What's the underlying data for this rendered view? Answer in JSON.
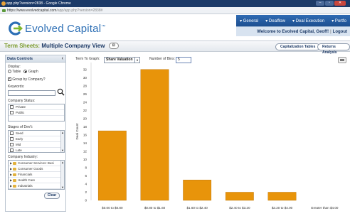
{
  "browser": {
    "title": "app.php?version=2838 - Google Chrome",
    "url_host": "https://www.evolvedcapital.com",
    "url_path": "/app/app.php?version=2838#",
    "win_min": "–",
    "win_max": "▫",
    "win_close": "✕"
  },
  "header": {
    "brand": "Evolved Capital",
    "brand_tm": "™",
    "nav": [
      "▾ General",
      "▾ Dealflow",
      "▾ Deal Execution",
      "▾ Portfo"
    ],
    "welcome": "Welcome to Evolved Capital, Geoff!",
    "logout": "Logout"
  },
  "page": {
    "title_prefix": "Term Sheets:",
    "title_main": "Multiple Company View",
    "view_icon": "⊡",
    "cap_tables_btn": "Capitalization Tables",
    "returns_btn": "Returns Analysis"
  },
  "panel": {
    "heading": "Data Controls",
    "collapse": "‹",
    "display_label": "Display:",
    "table_label": "Table",
    "graph_label": "Graph",
    "group_label": "Group by Company?",
    "keywords_label": "Keywords:",
    "search_glyph": "🔍",
    "status_label": "Company Status:",
    "status_items": [
      "Private",
      "Public"
    ],
    "stage_label": "Stages of Dev't:",
    "stage_items": [
      "Seed",
      "Early",
      "Mid",
      "Late"
    ],
    "industry_label": "Company Industry:",
    "industry_items": [
      "Consumer Services: Busi",
      "Consumer Goods",
      "Financials",
      "Health Care",
      "Industrials"
    ],
    "clear": "Clear",
    "up": "▲",
    "down": "▼"
  },
  "controls": {
    "term_label": "Term To Graph:",
    "term_value": "Share Valuation",
    "dd": "▾",
    "bins_label": "Number of Bins:",
    "bins_value": "5"
  },
  "chart_data": {
    "type": "bar",
    "categories": [
      "$0.00 to $0.80",
      "$0.80 to $1.60",
      "$1.60 to $2.40",
      "$2.40 to $3.20",
      "$3.20 to $4.00",
      "Greater than $4.00"
    ],
    "values": [
      17,
      32,
      5,
      2,
      2,
      0
    ],
    "ylabel": "Deal Count",
    "ylim": [
      0,
      33
    ],
    "yticks": [
      0,
      2,
      4,
      6,
      8,
      10,
      12,
      14,
      16,
      18,
      20,
      22,
      24,
      26,
      28,
      30,
      32
    ],
    "bar_color": "#e8940a",
    "grid": false
  }
}
